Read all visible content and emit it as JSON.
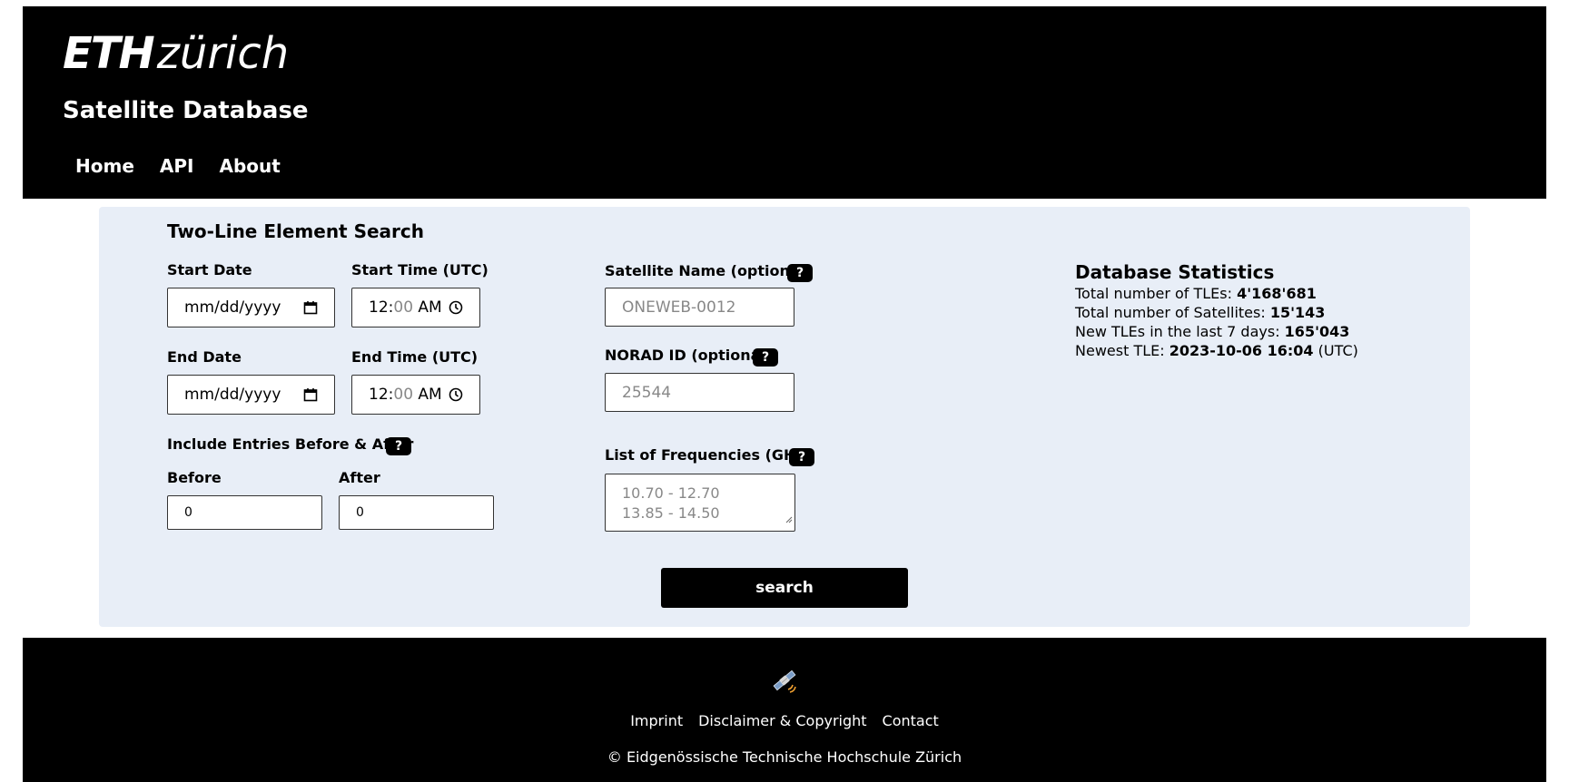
{
  "header": {
    "logo_eth": "ETH",
    "logo_zurich": "zürich",
    "site_title": "Satellite Database",
    "nav": [
      {
        "label": "Home"
      },
      {
        "label": "API"
      },
      {
        "label": "About"
      }
    ]
  },
  "form": {
    "title": "Two-Line Element Search",
    "start_date": {
      "label": "Start Date",
      "value": "mm/dd/yyyy"
    },
    "start_time": {
      "label": "Start Time (UTC)",
      "hour": "12",
      "minute": "00",
      "ampm": "AM"
    },
    "end_date": {
      "label": "End Date",
      "value": "mm/dd/yyyy"
    },
    "end_time": {
      "label": "End Time (UTC)",
      "hour": "12",
      "minute": "00",
      "ampm": "AM"
    },
    "include_label": "Include Entries Before & After",
    "before": {
      "label": "Before",
      "value": "0"
    },
    "after": {
      "label": "After",
      "value": "0"
    },
    "satellite_name": {
      "label": "Satellite Name (optional)",
      "placeholder": "ONEWEB-0012"
    },
    "norad_id": {
      "label": "NORAD ID (optional)",
      "placeholder": "25544"
    },
    "frequencies": {
      "label": "List of Frequencies (GHz)",
      "placeholder_lines": [
        "10.70 - 12.70",
        "13.85 - 14.50"
      ]
    },
    "help_symbol": "?",
    "search_label": "search"
  },
  "stats": {
    "title": "Database Statistics",
    "total_tles_label": "Total number of TLEs: ",
    "total_tles": "4'168'681",
    "total_sats_label": "Total number of Satellites: ",
    "total_sats": "15'143",
    "new_tles_label": "New TLEs in the last 7 days: ",
    "new_tles": "165'043",
    "newest_label": "Newest TLE: ",
    "newest_value": "2023-10-06 16:04",
    "newest_suffix": " (UTC)"
  },
  "footer": {
    "links": [
      {
        "label": "Imprint"
      },
      {
        "label": "Disclaimer & Copyright"
      },
      {
        "label": "Contact"
      }
    ],
    "copyright": "© Eidgenössische Technische Hochschule Zürich"
  }
}
